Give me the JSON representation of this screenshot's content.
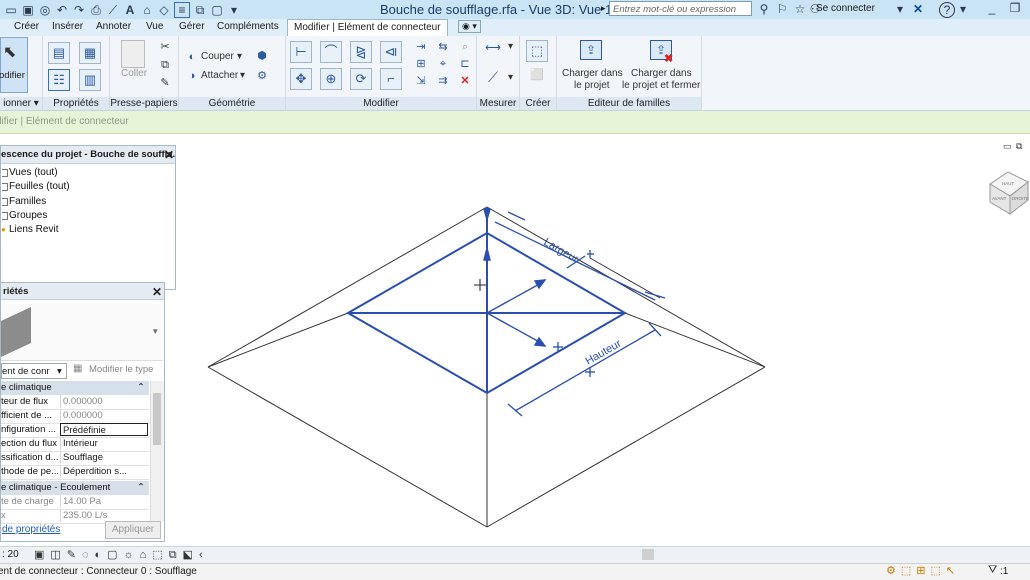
{
  "titlebar": {
    "document_title": "Bouche de soufflage.rfa - Vue 3D: Vue 1",
    "search_placeholder": "Entrez mot-clé ou expression",
    "sign_in": "Se connecter"
  },
  "tabs": [
    "Créer",
    "Insérer",
    "Annoter",
    "Vue",
    "Gérer",
    "Compléments"
  ],
  "active_tab": "Modifier | Elément de connecteur",
  "ribbon": {
    "select": {
      "button": "odifier",
      "label": "ionner"
    },
    "properties": {
      "label": "Propriétés"
    },
    "clipboard": {
      "paste": "Coller",
      "label": "Presse-papiers"
    },
    "geometry": {
      "cut": "Couper",
      "join": "Attacher",
      "label": "Géométrie"
    },
    "modify": {
      "label": "Modifier"
    },
    "measure": {
      "label": "Mesurer"
    },
    "create": {
      "label": "Créer"
    },
    "family_editor": {
      "load_project_1": "Charger dans",
      "load_project_2": "le projet",
      "load_close_1": "Charger dans",
      "load_close_2": "le projet et fermer",
      "label": "Editeur de familles"
    }
  },
  "options_bar": {
    "text": "difier | Elément de connecteur"
  },
  "project_browser": {
    "title": "escence du projet - Bouche de souffla...",
    "items": [
      "Vues (tout)",
      "Feuilles (tout)",
      "Familles",
      "Groupes",
      "Liens Revit"
    ]
  },
  "properties": {
    "title": "riétés",
    "type_selector": "ent de conr",
    "edit_type": "Modifier le type",
    "groups": [
      "e climatique",
      "e climatique - Ecoulement"
    ],
    "rows": [
      {
        "name": "teur de flux",
        "value": "0.000000"
      },
      {
        "name": "fficient de ...",
        "value": "0.000000"
      },
      {
        "name": "nfiguration ...",
        "value": "Prédéfinie"
      },
      {
        "name": "ection du flux",
        "value": "Intérieur"
      },
      {
        "name": "ssification d...",
        "value": "Soufflage"
      },
      {
        "name": "thode de pe...",
        "value": "Déperdition s..."
      }
    ],
    "rows2": [
      {
        "name": "te de charge",
        "value": "14.00 Pa"
      },
      {
        "name": "x",
        "value": "235.00 L/s"
      }
    ],
    "help_link": "de propriétés",
    "apply": "Appliquer"
  },
  "canvas": {
    "dim_width": "Largeur",
    "dim_height": "Hauteur",
    "viewcube_top": "HAUT",
    "viewcube_front": "AVANT",
    "viewcube_right": "DROITE"
  },
  "view_controls": {
    "scale": ": 20"
  },
  "status_bar": {
    "text": "ent de connecteur : Connecteur 0 : Soufflage",
    "filter": ":1"
  },
  "colors": {
    "selection": "#2a4fb0",
    "options_bar": "#e8f4d6",
    "ribbon_tab_bar": "#dfeef9"
  }
}
